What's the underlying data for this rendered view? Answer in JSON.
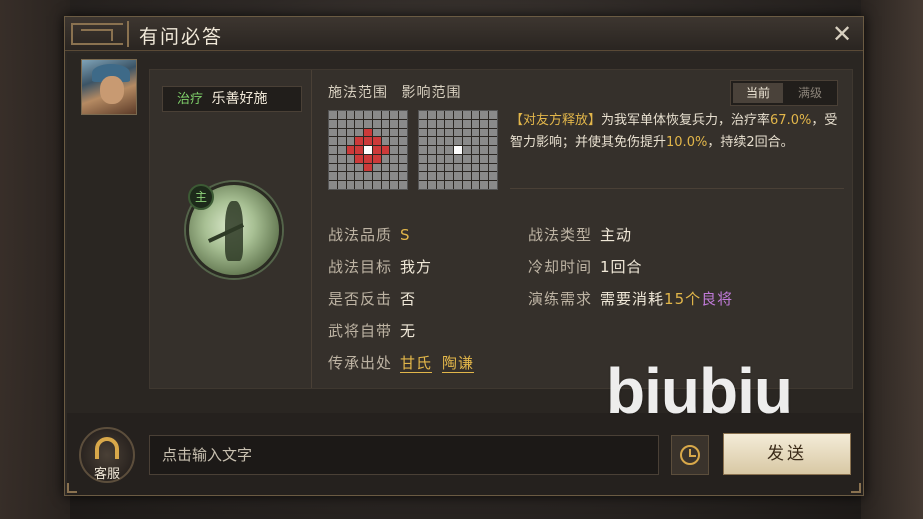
{
  "dialog": {
    "title": "有问必答"
  },
  "skill": {
    "tag": "治疗",
    "name": "乐善好施",
    "icon_badge": "主"
  },
  "range": {
    "cast_label": "施法范围",
    "effect_label": "影响范围",
    "toggle_current": "当前",
    "toggle_max": "满级"
  },
  "description": {
    "target": "【对友方释放】",
    "part1": "为我军单体恢复兵力，治疗率",
    "heal_rate": "67.0%",
    "part2": "，受智力影响；并使其免伤提升",
    "dmg_reduction": "10.0%",
    "part3": "，持续2回合。"
  },
  "attributes": {
    "quality_k": "战法品质",
    "quality_v": "S",
    "target_k": "战法目标",
    "target_v": "我方",
    "counter_k": "是否反击",
    "counter_v": "否",
    "innate_k": "武将自带",
    "innate_v": "无",
    "inherit_k": "传承出处",
    "inherit_v1": "甘氏",
    "inherit_v2": "陶谦",
    "type_k": "战法类型",
    "type_v": "主动",
    "cooldown_k": "冷却时间",
    "cooldown_v": "1回合",
    "train_k": "演练需求",
    "train_v_pre": "需要消耗",
    "train_v_num": "15个",
    "train_v_quality": "良将"
  },
  "bottom": {
    "customer_service": "客服",
    "input_placeholder": "点击输入文字",
    "send": "发送"
  },
  "watermark": "biubiu",
  "colors": {
    "gold": "#e2b64a",
    "heal_green": "#7fd06a",
    "purple": "#c07ad8",
    "range_red": "#cc3a3a"
  }
}
